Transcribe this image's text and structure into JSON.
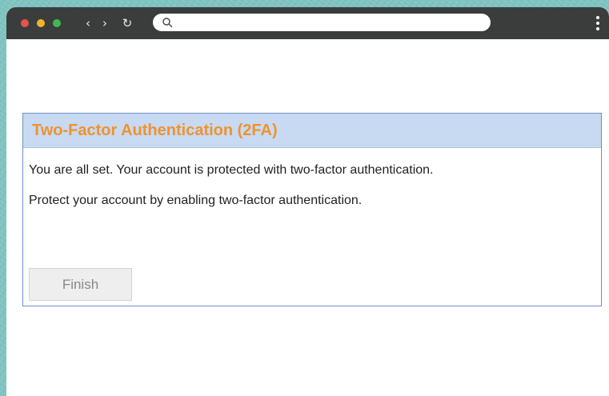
{
  "browser": {
    "traffic_lights": [
      {
        "name": "close",
        "color": "#e5534b"
      },
      {
        "name": "minimize",
        "color": "#f0b429"
      },
      {
        "name": "maximize",
        "color": "#3fb950"
      }
    ],
    "nav": {
      "back_glyph": "‹",
      "forward_glyph": "›",
      "reload_glyph": "↻"
    },
    "address": {
      "value": "",
      "placeholder": ""
    },
    "icons": [
      "search-icon",
      "kebab-menu-icon"
    ]
  },
  "panel": {
    "title": "Two-Factor Authentication (2FA)",
    "message_1": "You are all set. Your account is protected with two-factor authentication.",
    "message_2": "Protect your account by enabling two-factor authentication.",
    "finish_label": "Finish"
  },
  "colors": {
    "title": "#f0922f",
    "header_bg": "#c7daf2",
    "panel_border": "#6f8fc6",
    "chrome_bar": "#3b3d3c"
  }
}
